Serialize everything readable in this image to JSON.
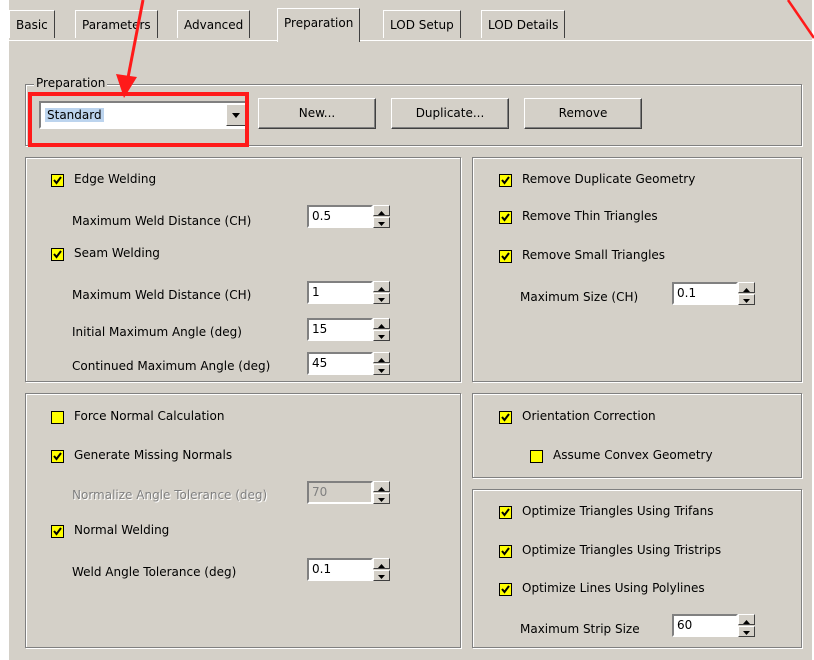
{
  "tabs": [
    {
      "label": "Basic",
      "active": false
    },
    {
      "label": "Parameters",
      "active": false
    },
    {
      "label": "Advanced",
      "active": false
    },
    {
      "label": "Preparation",
      "active": true
    },
    {
      "label": "LOD Setup",
      "active": false
    },
    {
      "label": "LOD Details",
      "active": false
    }
  ],
  "preparation": {
    "legend": "Preparation",
    "combo_value": "Standard",
    "new_button": "New...",
    "duplicate_button": "Duplicate...",
    "remove_button": "Remove"
  },
  "welding": {
    "edge_welding": {
      "label": "Edge Welding",
      "checked": true
    },
    "edge_max_dist": {
      "label": "Maximum Weld Distance (CH)",
      "value": "0.5"
    },
    "seam_welding": {
      "label": "Seam Welding",
      "checked": true
    },
    "seam_max_dist": {
      "label": "Maximum Weld Distance (CH)",
      "value": "1"
    },
    "initial_max_angle": {
      "label": "Initial Maximum Angle (deg)",
      "value": "15"
    },
    "continued_max_angle": {
      "label": "Continued Maximum Angle (deg)",
      "value": "45"
    }
  },
  "geometry": {
    "remove_duplicate": {
      "label": "Remove Duplicate Geometry",
      "checked": true
    },
    "remove_thin": {
      "label": "Remove Thin Triangles",
      "checked": true
    },
    "remove_small": {
      "label": "Remove Small Triangles",
      "checked": true
    },
    "max_size": {
      "label": "Maximum Size (CH)",
      "value": "0.1"
    }
  },
  "normals": {
    "force_normal": {
      "label": "Force Normal Calculation",
      "checked": false
    },
    "generate_missing": {
      "label": "Generate Missing Normals",
      "checked": true
    },
    "normalize_tolerance": {
      "label": "Normalize Angle Tolerance (deg)",
      "value": "70",
      "disabled": true
    },
    "normal_welding": {
      "label": "Normal Welding",
      "checked": true
    },
    "weld_tolerance": {
      "label": "Weld Angle Tolerance (deg)",
      "value": "0.1"
    }
  },
  "orientation": {
    "orientation_correction": {
      "label": "Orientation Correction",
      "checked": true
    },
    "assume_convex": {
      "label": "Assume Convex Geometry",
      "checked": false
    }
  },
  "optimize": {
    "trifans": {
      "label": "Optimize Triangles Using Trifans",
      "checked": true
    },
    "tristrips": {
      "label": "Optimize Triangles Using Tristrips",
      "checked": true
    },
    "polylines": {
      "label": "Optimize Lines Using Polylines",
      "checked": true
    },
    "max_strip": {
      "label": "Maximum Strip Size",
      "value": "60"
    }
  },
  "annotation_colors": {
    "highlight": "#ff1a1a",
    "checkbox_fill": "#ffff00",
    "selection": "#bcd4ee"
  },
  "icons": [
    "checkmark-icon",
    "dropdown-arrow-icon",
    "spin-up-icon",
    "spin-down-icon",
    "annotation-arrow-icon"
  ]
}
